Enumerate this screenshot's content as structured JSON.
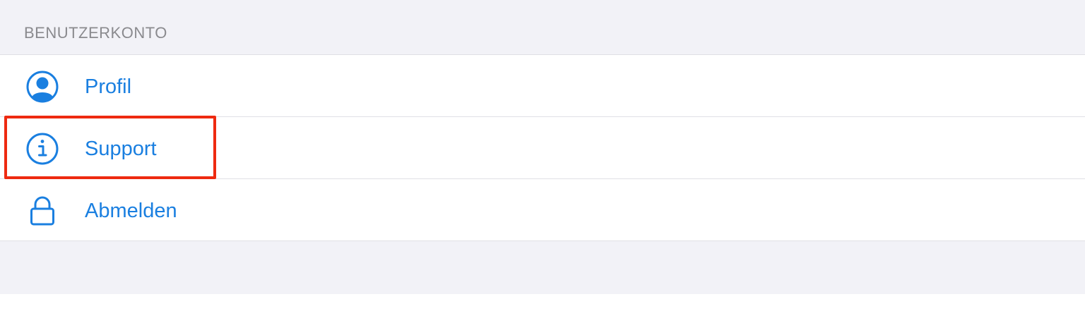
{
  "section": {
    "title": "BENUTZERKONTO"
  },
  "items": [
    {
      "label": "Profil",
      "icon": "person-circle-icon"
    },
    {
      "label": "Support",
      "icon": "info-circle-icon"
    },
    {
      "label": "Abmelden",
      "icon": "lock-icon"
    }
  ],
  "colors": {
    "accent": "#1a7fe0",
    "header_text": "#8a8a8e",
    "grouped_background": "#f2f2f7",
    "separator": "#e0e0e5",
    "highlight": "#ee2a10"
  }
}
